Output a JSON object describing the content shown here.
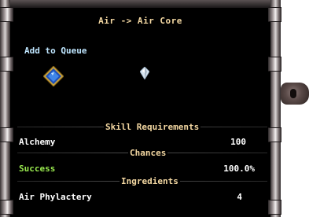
{
  "window": {
    "title": "Air -> Air Core"
  },
  "actions": {
    "add_to_queue": "Add to Queue"
  },
  "items": {
    "gem_icon": "blue-gem-icon",
    "result_icon": "air-core-crystal-icon"
  },
  "sections": {
    "skill_requirements": "Skill Requirements",
    "chances": "Chances",
    "ingredients": "Ingredients"
  },
  "skill_requirements": [
    {
      "name": "Alchemy",
      "value": "100"
    }
  ],
  "chances": [
    {
      "name": "Success",
      "value": "100.0%"
    }
  ],
  "ingredients": [
    {
      "name": "Air Phylactery",
      "value": "4"
    }
  ],
  "colors": {
    "title": "#f4d8a2",
    "link": "#bfe6ff",
    "success": "#98e84e",
    "text": "#ffffff"
  }
}
